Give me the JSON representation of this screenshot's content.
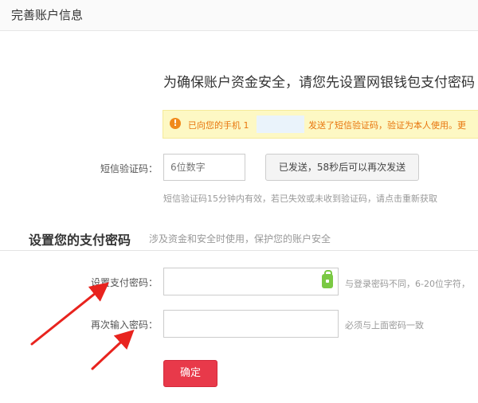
{
  "header": {
    "title": "完善账户信息"
  },
  "notice": {
    "text": "为确保账户资金安全，请您先设置网银钱包支付密码"
  },
  "alert": {
    "prefix": "已向您的手机 1",
    "suffix": "发送了短信验证码，验证为本人使用。更",
    "icon": "warning-icon",
    "color": "#e8760e"
  },
  "sms": {
    "label": "短信验证码：",
    "placeholder": "6位数字",
    "button_label": "已发送，58秒后可以再次发送",
    "hint": "短信验证码15分钟内有效，若已失效或未收到验证码，请点击重新获取"
  },
  "password_section": {
    "title": "设置您的支付密码",
    "subtitle": "涉及资金和安全时使用，保护您的账户安全"
  },
  "password": {
    "label": "设置支付密码：",
    "hint": "与登录密码不同，6-20位字符，",
    "icon": "lock-icon"
  },
  "password_confirm": {
    "label": "再次输入密码：",
    "hint": "必须与上面密码一致"
  },
  "confirm": {
    "label": "确定",
    "color": "#e8394a"
  },
  "annotation": {
    "arrow_color": "#e8231e"
  }
}
